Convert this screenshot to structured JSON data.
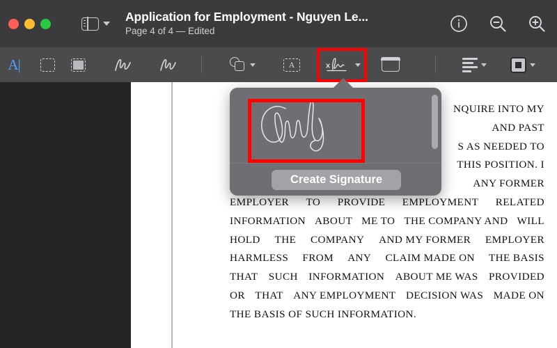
{
  "window": {
    "title": "Application for Employment - Nguyen Le...",
    "subtitle": "Page 4 of 4 — Edited",
    "traffic_lights": [
      "close",
      "minimize",
      "zoom"
    ],
    "colors": {
      "close": "#ff5f57",
      "minimize": "#febc2e",
      "zoom": "#28c840",
      "titlebar": "#3b3b3d",
      "toolbar": "#4b4b4d",
      "highlight": "#ff0000"
    }
  },
  "header": {
    "sidebar_toggle": "sidebar-view-icon",
    "actions": [
      {
        "name": "info-icon",
        "label": "Info"
      },
      {
        "name": "zoom-out-icon",
        "label": "Zoom Out"
      },
      {
        "name": "zoom-in-icon",
        "label": "Zoom In"
      }
    ]
  },
  "toolbar": {
    "tools": [
      {
        "name": "text-selection-tool",
        "label": "Text Selection",
        "icon": "text-cursor-icon"
      },
      {
        "name": "rectangular-selection-tool",
        "label": "Rectangular Selection",
        "icon": "dashed-rectangle-icon"
      },
      {
        "name": "instant-alpha-tool",
        "label": "Instant Alpha",
        "icon": "filled-dashed-rectangle-icon"
      },
      {
        "name": "sketch-tool",
        "label": "Sketch",
        "icon": "squiggle-icon"
      },
      {
        "name": "draw-tool",
        "label": "Draw",
        "icon": "squiggle-icon"
      },
      {
        "name": "shapes-tool",
        "label": "Shapes",
        "icon": "shapes-icon"
      },
      {
        "name": "text-tool",
        "label": "Text",
        "icon": "text-box-icon"
      },
      {
        "name": "sign-tool",
        "label": "Sign",
        "icon": "signature-icon"
      },
      {
        "name": "note-tool",
        "label": "Note",
        "icon": "note-icon"
      },
      {
        "name": "text-style-tool",
        "label": "Text Style",
        "icon": "lines-icon"
      },
      {
        "name": "shape-style-tool",
        "label": "Shape Style",
        "icon": "shape-style-icon"
      }
    ]
  },
  "signature_popover": {
    "signature_name": "Chuky",
    "create_button_label": "Create Signature",
    "scrollbar": "vertical-scrollbar"
  },
  "document": {
    "lines": [
      {
        "left": "",
        "right": "NQUIRE  INTO  MY",
        "justify": "right"
      },
      {
        "left": "",
        "right": "AND          PAST",
        "justify": "right"
      },
      {
        "left": "",
        "right": "S AS NEEDED TO",
        "justify": "right"
      },
      {
        "left": "",
        "right": "THIS POSITION. I",
        "justify": "right"
      },
      {
        "left": "",
        "right": "ANY   FORMER",
        "justify": "right"
      },
      {
        "left": "EMPLOYER",
        "mid1": "TO",
        "mid2": "PROVIDE",
        "mid3": "EMPLOYMENT",
        "right": "RELATED"
      },
      {
        "left": "INFORMATION",
        "mid1": "ABOUT",
        "mid2": "ME TO",
        "mid3": "THE COMPANY AND",
        "right": "WILL"
      },
      {
        "left": "HOLD",
        "mid1": "THE",
        "mid2": "COMPANY",
        "mid3": "AND   MY   FORMER",
        "right": "EMPLOYER"
      },
      {
        "left": "HARMLESS",
        "mid1": "FROM",
        "mid2": "ANY",
        "mid3": "CLAIM   MADE   ON",
        "right": "THE  BASIS"
      },
      {
        "left": "THAT",
        "mid1": "SUCH",
        "mid2": "INFORMATION",
        "mid3": "ABOUT  ME  WAS",
        "right": "PROVIDED"
      },
      {
        "left": "OR",
        "mid1": "THAT",
        "mid2": "ANY EMPLOYMENT",
        "mid3": "DECISION  WAS",
        "right": "MADE ON"
      },
      {
        "left": "THE BASIS OF SUCH INFORMATION.",
        "justify": "left"
      }
    ]
  }
}
